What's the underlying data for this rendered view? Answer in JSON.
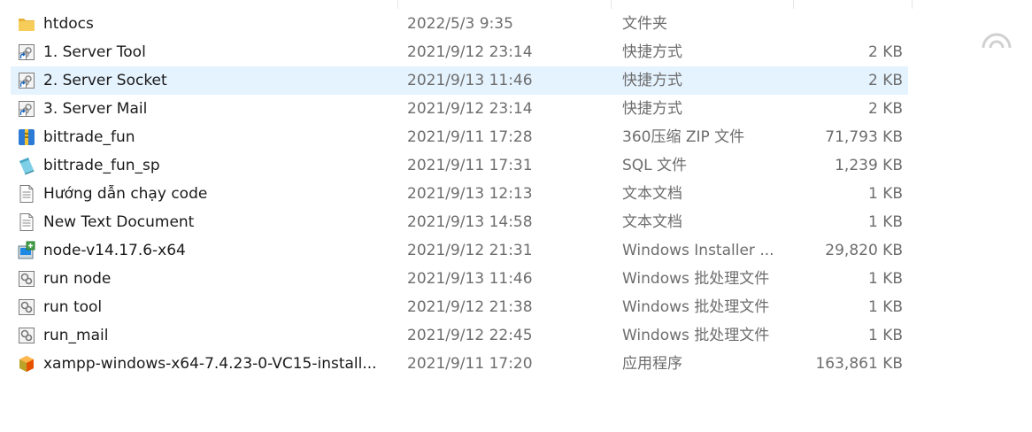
{
  "files": [
    {
      "name": "htdocs",
      "date": "2022/5/3 9:35",
      "type": "文件夹",
      "size": "",
      "icon": "folder-icon"
    },
    {
      "name": "1. Server Tool",
      "date": "2021/9/12 23:14",
      "type": "快捷方式",
      "size": "2 KB",
      "icon": "shortcut-icon"
    },
    {
      "name": "2. Server Socket",
      "date": "2021/9/13 11:46",
      "type": "快捷方式",
      "size": "2 KB",
      "icon": "shortcut-icon",
      "selected": true
    },
    {
      "name": "3. Server Mail",
      "date": "2021/9/12 23:14",
      "type": "快捷方式",
      "size": "2 KB",
      "icon": "shortcut-icon"
    },
    {
      "name": "bittrade_fun",
      "date": "2021/9/11 17:28",
      "type": "360压缩 ZIP 文件",
      "size": "71,793 KB",
      "icon": "zip-archive-icon"
    },
    {
      "name": "bittrade_fun_sp",
      "date": "2021/9/11 17:31",
      "type": "SQL 文件",
      "size": "1,239 KB",
      "icon": "sql-file-icon"
    },
    {
      "name": "Hướng dẫn chạy code",
      "date": "2021/9/13 12:13",
      "type": "文本文档",
      "size": "1 KB",
      "icon": "text-document-icon"
    },
    {
      "name": "New Text Document",
      "date": "2021/9/13 14:58",
      "type": "文本文档",
      "size": "1 KB",
      "icon": "text-document-icon"
    },
    {
      "name": "node-v14.17.6-x64",
      "date": "2021/9/12 21:31",
      "type": "Windows Installer ...",
      "size": "29,820 KB",
      "icon": "installer-icon"
    },
    {
      "name": "run node",
      "date": "2021/9/13 11:46",
      "type": "Windows 批处理文件",
      "size": "1 KB",
      "icon": "batch-file-icon"
    },
    {
      "name": "run tool",
      "date": "2021/9/12 21:38",
      "type": "Windows 批处理文件",
      "size": "1 KB",
      "icon": "batch-file-icon"
    },
    {
      "name": "run_mail",
      "date": "2021/9/12 22:45",
      "type": "Windows 批处理文件",
      "size": "1 KB",
      "icon": "batch-file-icon"
    },
    {
      "name": "xampp-windows-x64-7.4.23-0-VC15-install...",
      "date": "2021/9/11 17:20",
      "type": "应用程序",
      "size": "163,861 KB",
      "icon": "application-icon"
    }
  ],
  "colors": {
    "selection": "#e5f3ff",
    "secondary_text": "#6d6d6d",
    "primary_text": "#1a1a1a",
    "folder": "#f3c44e"
  }
}
